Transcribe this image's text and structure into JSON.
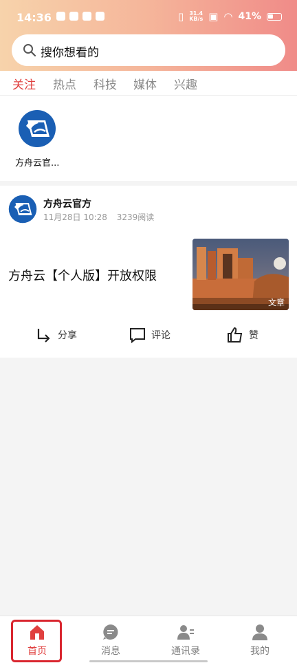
{
  "status_bar": {
    "time": "14:36",
    "net_speed_top": "31.4",
    "net_speed_bottom": "KB/s",
    "battery_percent": "41%"
  },
  "search": {
    "placeholder": "搜你想看的"
  },
  "tabs": [
    {
      "label": "关注",
      "active": true
    },
    {
      "label": "热点"
    },
    {
      "label": "科技"
    },
    {
      "label": "媒体"
    },
    {
      "label": "兴趣"
    }
  ],
  "following": [
    {
      "name": "方舟云官..."
    }
  ],
  "post": {
    "author": "方舟云官方",
    "date": "11月28日 10:28",
    "reads": "3239阅读",
    "title": "方舟云【个人版】开放权限",
    "thumb_label": "文章",
    "actions": {
      "share": "分享",
      "comment": "评论",
      "like": "赞"
    }
  },
  "bottom_nav": [
    {
      "label": "首页",
      "active": true
    },
    {
      "label": "消息"
    },
    {
      "label": "通讯录"
    },
    {
      "label": "我的"
    }
  ],
  "colors": {
    "accent": "#e0403f",
    "brand_blue": "#1a5fb4"
  }
}
